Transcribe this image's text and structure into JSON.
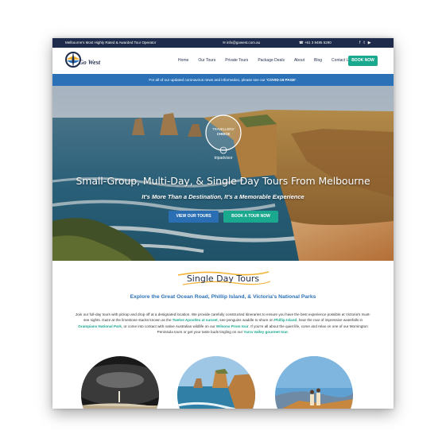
{
  "topbar": {
    "tagline": "Melbourne's Most Highly Rated & Awarded Tour Operator",
    "email": "info@gowest.com.au",
    "phone": "+61 3 9485 5290",
    "social_icons": [
      "facebook-icon",
      "twitter-icon",
      "youtube-icon"
    ]
  },
  "logo": {
    "text": "Go West"
  },
  "nav": {
    "items": [
      "Home",
      "Our Tours",
      "Private Tours",
      "Package Deals",
      "About",
      "Blog",
      "Contact Us"
    ],
    "cta": "BOOK NOW"
  },
  "notice": {
    "prefix": "For all of our updated coronavirus news and information, please see our ",
    "link": "'COVID-19 PAGE'",
    "suffix": "."
  },
  "hero": {
    "badge_line1": "TRAVELLERS'",
    "badge_line2": "CHOICE",
    "badge_brand": "tripadvisor",
    "title": "Small-Group, Multi-Day, & Single Day Tours From Melbourne",
    "subtitle": "It's More Than a Destination, It's a Memorable Experience",
    "btn_tours": "VIEW OUR TOURS",
    "btn_book": "BOOK A TOUR NOW"
  },
  "section": {
    "title": "Single Day Tours",
    "subtitle": "Explore the Great Ocean Road, Phillip Island, & Victoria's National Parks",
    "intro_1": "Join our full-day tours with pickup and drop off at a designated location. We provide carefully constructed itineraries to ensure you have the best experience possible at Victoria's must-see sights. Gaze at the limestone stacks known as the ",
    "link_apostles": "Twelve Apostles at sunset",
    "intro_2": ", see penguins waddle to shore on ",
    "link_phillip": "Phillip Island",
    "intro_3": ", hear the roar of impressive waterfalls in ",
    "link_grampians": "Grampians National Park",
    "intro_4": ", or come into contact with native Australian wildlife on our ",
    "link_wilsons": "Wilsons Prom tour",
    "intro_5": ". If you're all about the quiet life, come and relax on one of our Mornington Peninsula tours or get your taste buds tingling on our ",
    "link_yarra": "Yarra Valley gourmet tour",
    "intro_6": "."
  },
  "colors": {
    "navy": "#1f2b4a",
    "teal": "#1aa88e",
    "blue": "#2a71b8"
  }
}
